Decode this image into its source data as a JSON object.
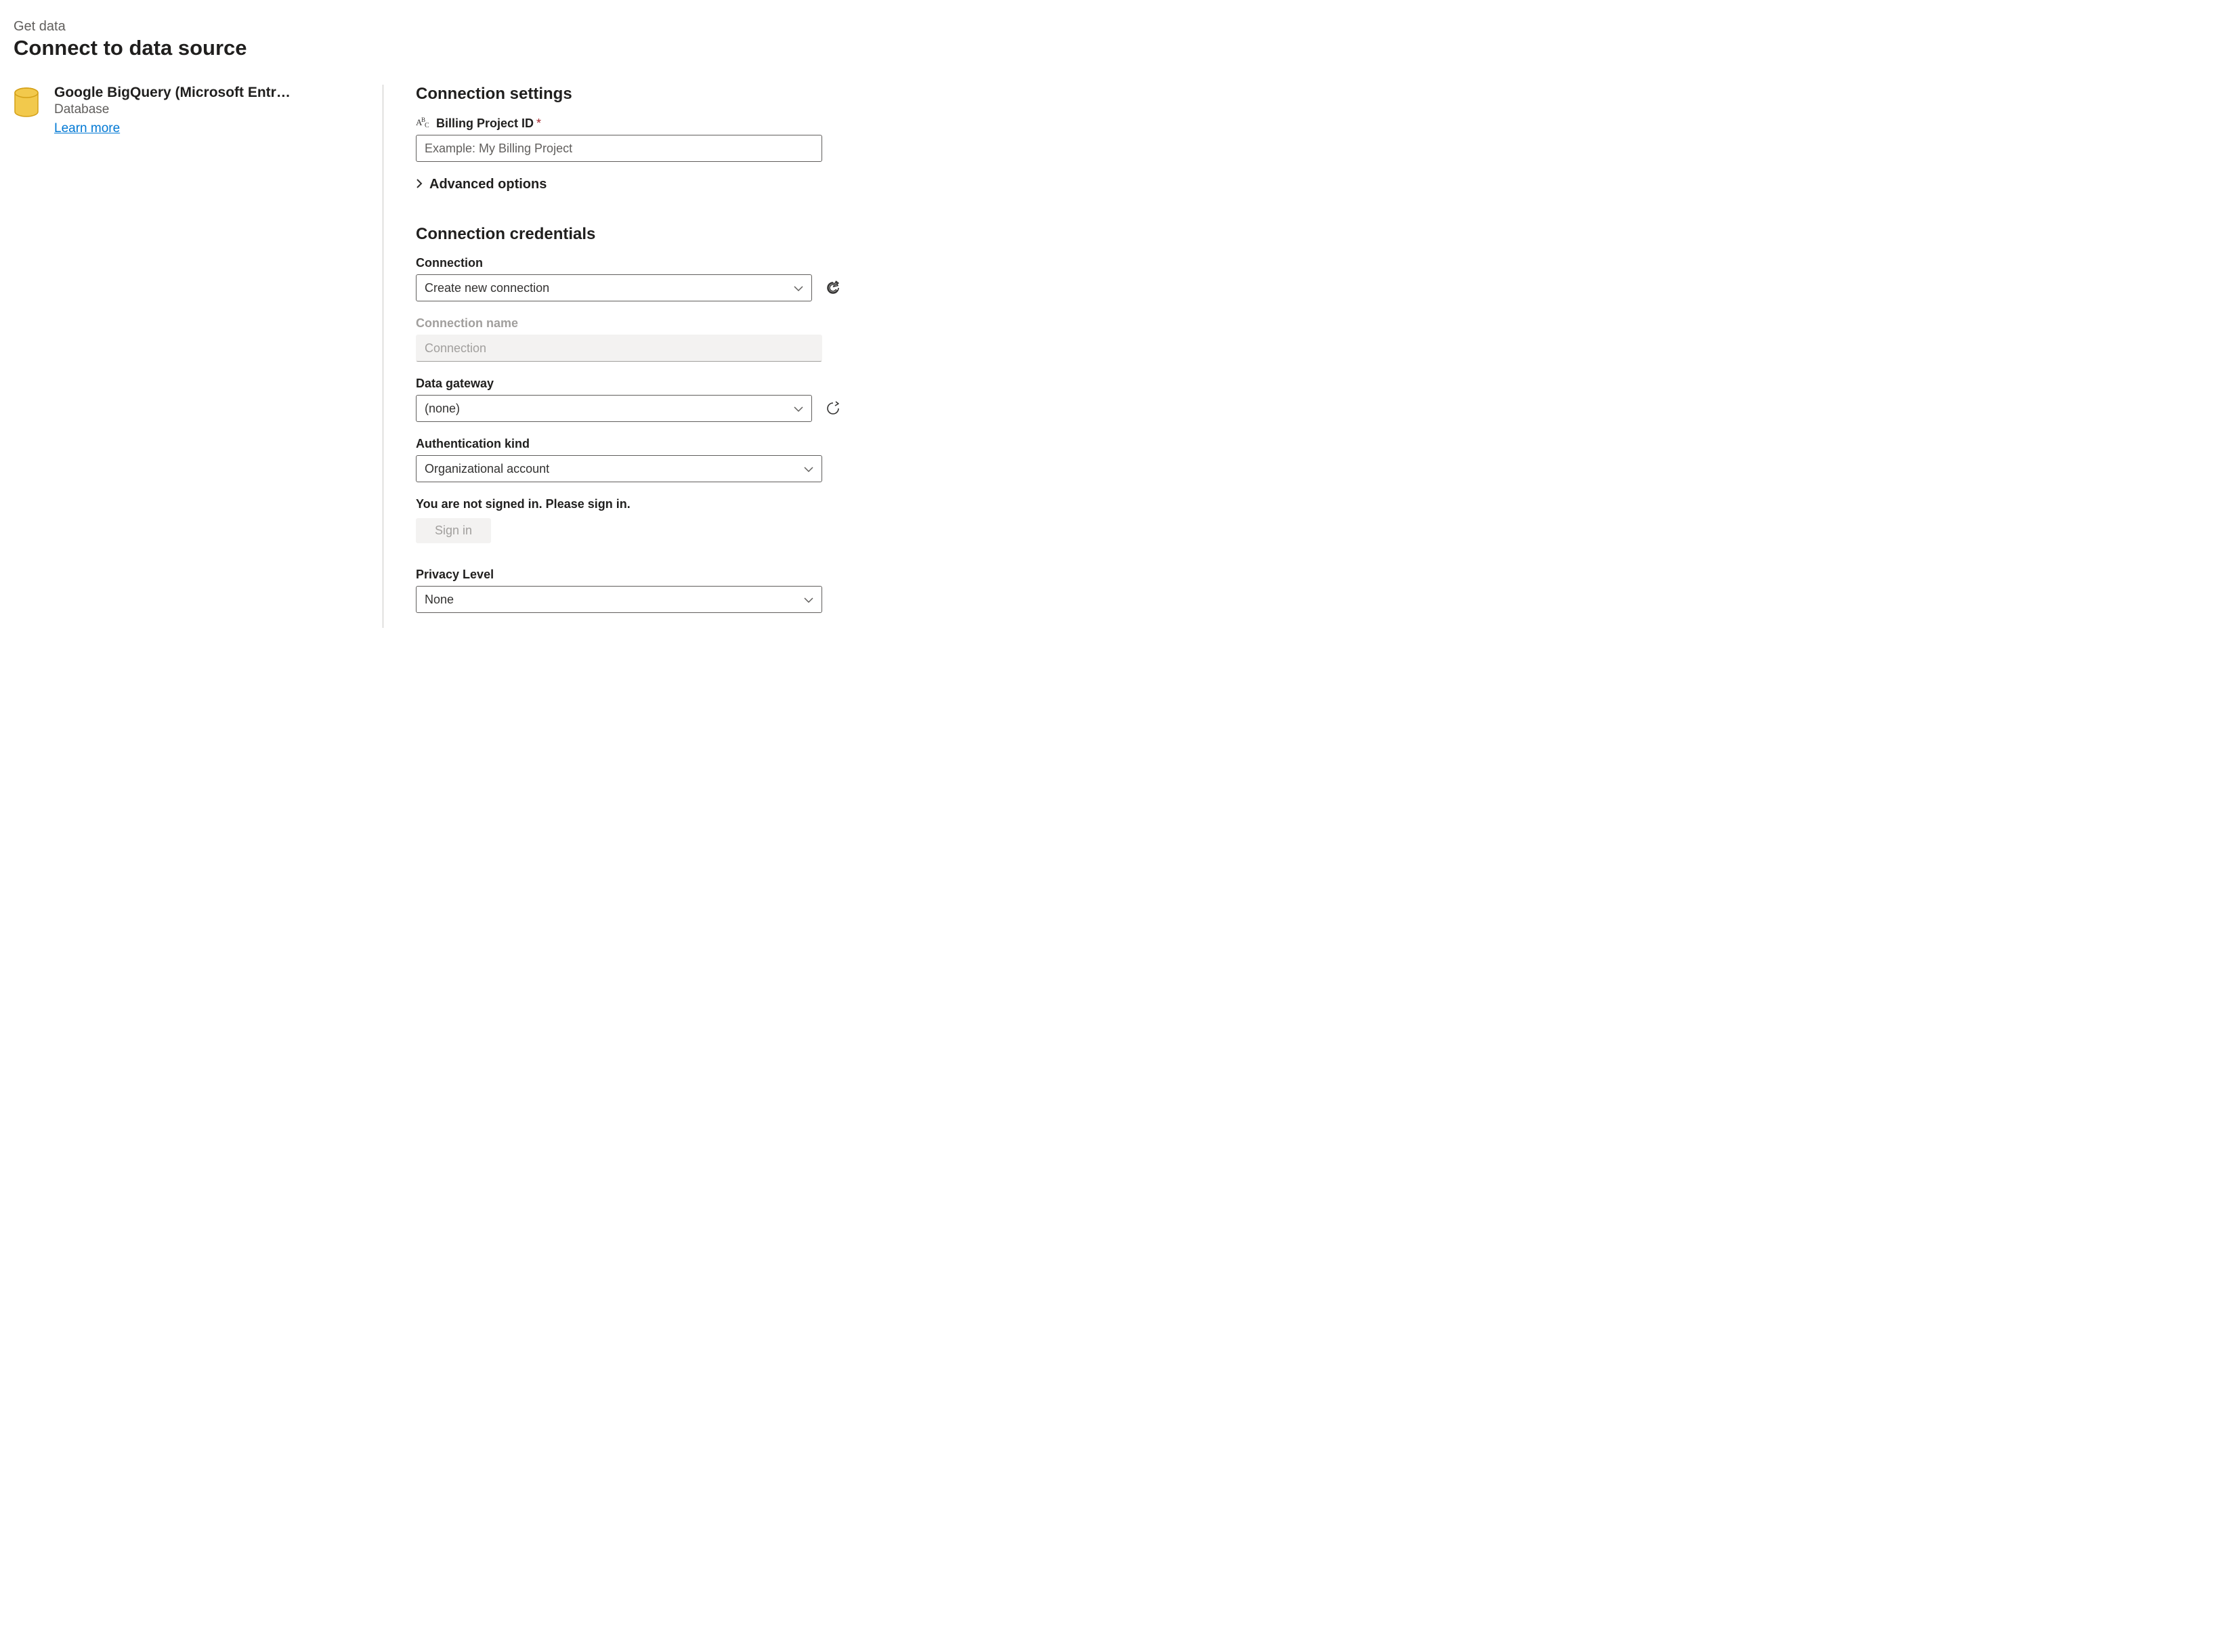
{
  "header": {
    "breadcrumb": "Get data",
    "title": "Connect to data source"
  },
  "connector": {
    "name": "Google BigQuery (Microsoft Entra...",
    "category": "Database",
    "learn_more": "Learn more"
  },
  "settings": {
    "heading": "Connection settings",
    "billing_project": {
      "type_hint": "ABC",
      "label": "Billing Project ID",
      "required_marker": "*",
      "placeholder": "Example: My Billing Project",
      "value": ""
    },
    "advanced_toggle": "Advanced options"
  },
  "credentials": {
    "heading": "Connection credentials",
    "connection": {
      "label": "Connection",
      "value": "Create new connection"
    },
    "connection_name": {
      "label": "Connection name",
      "placeholder": "Connection",
      "value": ""
    },
    "data_gateway": {
      "label": "Data gateway",
      "value": "(none)"
    },
    "auth_kind": {
      "label": "Authentication kind",
      "value": "Organizational account"
    },
    "signin_message": "You are not signed in. Please sign in.",
    "signin_button": "Sign in",
    "privacy_level": {
      "label": "Privacy Level",
      "value": "None"
    }
  }
}
